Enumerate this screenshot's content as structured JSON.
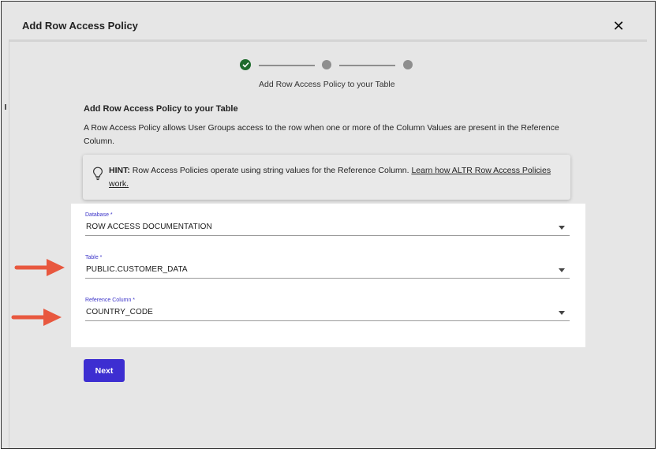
{
  "dialog": {
    "title": "Add Row Access Policy",
    "close_symbol": "✕"
  },
  "stepper": {
    "caption": "Add Row Access Policy to your Table",
    "steps": [
      {
        "state": "completed",
        "icon": "check-icon"
      },
      {
        "state": "pending"
      },
      {
        "state": "pending"
      }
    ]
  },
  "section": {
    "title": "Add Row Access Policy to your Table",
    "description": "A Row Access Policy allows User Groups access to the row when one or more of the Column Values are present in the Reference Column."
  },
  "hint": {
    "icon": "lightbulb-icon",
    "label": "HINT:",
    "text": " Row Access Policies operate using string values for the Reference Column. ",
    "link_text": "Learn how ALTR Row Access Policies work."
  },
  "form": {
    "database": {
      "label": "Database *",
      "value": "ROW ACCESS DOCUMENTATION"
    },
    "table": {
      "label": "Table *",
      "value": "PUBLIC.CUSTOMER_DATA"
    },
    "reference_column": {
      "label": "Reference Column *",
      "value": "COUNTRY_CODE"
    }
  },
  "actions": {
    "next_label": "Next"
  },
  "colors": {
    "accent": "#3d2ed1",
    "step_done": "#1e6b2c",
    "annotation_arrow": "#e8583f"
  }
}
